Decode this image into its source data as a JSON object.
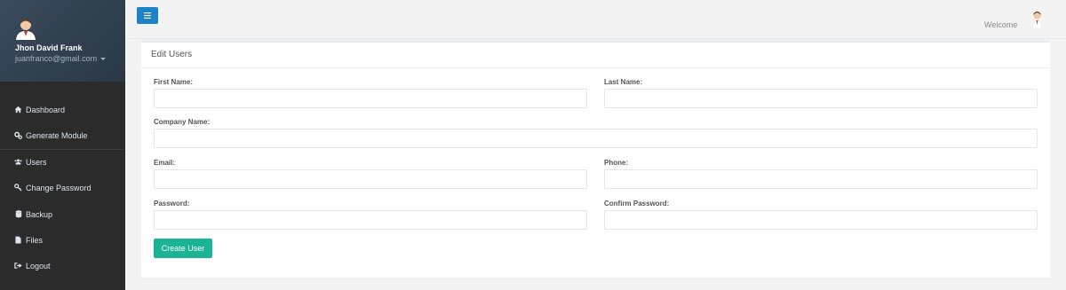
{
  "user": {
    "name": "Jhon David Frank",
    "email": "juanfranco@gmail.com"
  },
  "nav": {
    "items": [
      {
        "label": "Dashboard",
        "icon": "home-icon"
      },
      {
        "label": "Generate Module",
        "icon": "cogs-icon"
      },
      {
        "label": "Users",
        "icon": "users-icon"
      },
      {
        "label": "Change Password",
        "icon": "key-icon"
      },
      {
        "label": "Backup",
        "icon": "database-icon"
      },
      {
        "label": "Files",
        "icon": "file-icon"
      },
      {
        "label": "Logout",
        "icon": "sign-out-icon"
      }
    ]
  },
  "topbar": {
    "welcome": "Welcome"
  },
  "panel": {
    "title": "Edit Users"
  },
  "form": {
    "first_name_label": "First Name:",
    "first_name_value": "",
    "last_name_label": "Last Name:",
    "last_name_value": "",
    "company_name_label": "Company Name:",
    "company_name_value": "",
    "email_label": "Email:",
    "email_value": "",
    "phone_label": "Phone:",
    "phone_value": "",
    "password_label": "Password:",
    "password_value": "",
    "confirm_password_label": "Confirm Password:",
    "confirm_password_value": "",
    "submit_label": "Create User"
  },
  "colors": {
    "sidebar": "#2f4050",
    "nav_background": "#2b2b2b",
    "toggle_button": "#1c84c6",
    "primary_button": "#1ab394",
    "page_background": "#f3f3f4"
  }
}
